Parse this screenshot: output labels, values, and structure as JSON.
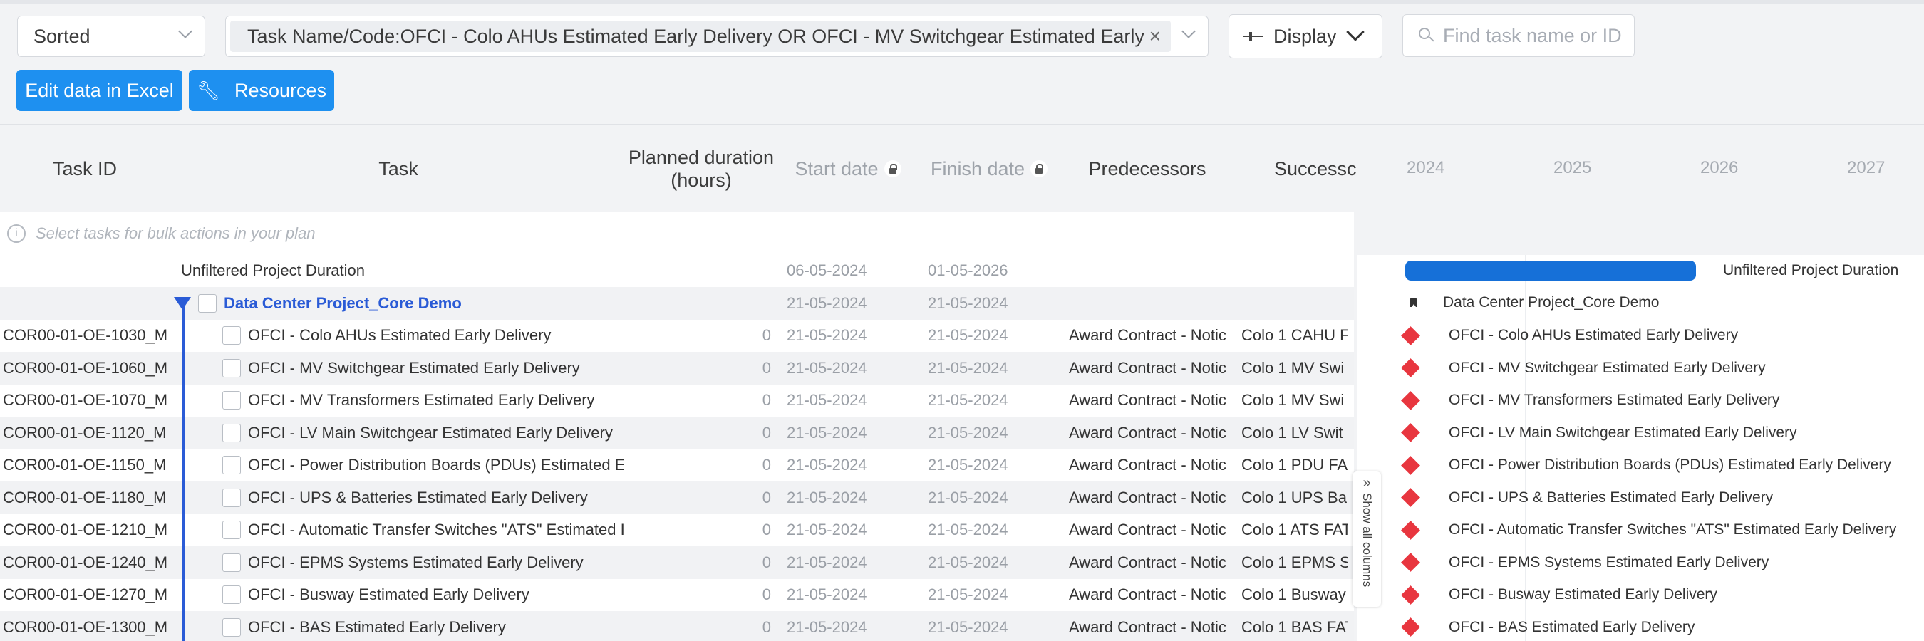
{
  "toolbar": {
    "sort_label": "Sorted",
    "filter_text": "Task Name/Code:OFCI - Colo AHUs Estimated Early Delivery OR OFCI - MV Switchgear Estimated Early Del...",
    "filter_clear": "×",
    "display_label": "Display",
    "search_placeholder": "Find task name or ID",
    "edit_excel_label": "Edit data in Excel",
    "resources_label": "Resources"
  },
  "columns": {
    "task_id": "Task ID",
    "task": "Task",
    "planned_duration": "Planned duration (hours)",
    "start_date": "Start date",
    "finish_date": "Finish date",
    "predecessors": "Predecessors",
    "successors": "Successc"
  },
  "timeline_years": [
    "2024",
    "2025",
    "2026",
    "2027"
  ],
  "bulk_actions_hint": "Select tasks for bulk actions in your plan",
  "summary_row": {
    "task": "Unfiltered Project Duration",
    "start": "06-05-2024",
    "finish": "01-05-2026"
  },
  "project_row": {
    "task": "Data Center Project_Core Demo",
    "start": "21-05-2024",
    "finish": "21-05-2024"
  },
  "tasks": [
    {
      "id": "COR00-01-OE-1030_M",
      "name": "OFCI - Colo AHUs Estimated Early Delivery",
      "duration": "0",
      "start": "21-05-2024",
      "finish": "21-05-2024",
      "pred": "Award Contract - Notic",
      "succ": "Colo 1 CAHU F",
      "gantt_label": "OFCI - Colo AHUs Estimated Early Delivery"
    },
    {
      "id": "COR00-01-OE-1060_M",
      "name": "OFCI - MV Switchgear Estimated Early Delivery",
      "duration": "0",
      "start": "21-05-2024",
      "finish": "21-05-2024",
      "pred": "Award Contract - Notic",
      "succ": "Colo 1 MV Swi",
      "gantt_label": "OFCI - MV Switchgear Estimated Early Delivery"
    },
    {
      "id": "COR00-01-OE-1070_M",
      "name": "OFCI - MV Transformers Estimated Early Delivery",
      "duration": "0",
      "start": "21-05-2024",
      "finish": "21-05-2024",
      "pred": "Award Contract - Notic",
      "succ": "Colo 1 MV Swi",
      "gantt_label": "OFCI - MV Transformers Estimated Early Delivery"
    },
    {
      "id": "COR00-01-OE-1120_M",
      "name": "OFCI - LV Main Switchgear Estimated Early Delivery",
      "duration": "0",
      "start": "21-05-2024",
      "finish": "21-05-2024",
      "pred": "Award Contract - Notic",
      "succ": "Colo 1 LV Swit",
      "gantt_label": "OFCI - LV Main Switchgear Estimated Early Delivery"
    },
    {
      "id": "COR00-01-OE-1150_M",
      "name": "OFCI - Power Distribution Boards (PDUs) Estimated E",
      "duration": "0",
      "start": "21-05-2024",
      "finish": "21-05-2024",
      "pred": "Award Contract - Notic",
      "succ": "Colo 1 PDU FA",
      "gantt_label": "OFCI - Power Distribution Boards (PDUs) Estimated Early Delivery"
    },
    {
      "id": "COR00-01-OE-1180_M",
      "name": "OFCI - UPS & Batteries Estimated Early Delivery",
      "duration": "0",
      "start": "21-05-2024",
      "finish": "21-05-2024",
      "pred": "Award Contract - Notic",
      "succ": "Colo 1 UPS Ba",
      "gantt_label": "OFCI - UPS & Batteries Estimated Early Delivery"
    },
    {
      "id": "COR00-01-OE-1210_M",
      "name": "OFCI - Automatic Transfer Switches \"ATS\" Estimated I",
      "duration": "0",
      "start": "21-05-2024",
      "finish": "21-05-2024",
      "pred": "Award Contract - Notic",
      "succ": "Colo 1 ATS FAT",
      "gantt_label": "OFCI - Automatic Transfer Switches \"ATS\" Estimated Early Delivery"
    },
    {
      "id": "COR00-01-OE-1240_M",
      "name": "OFCI - EPMS Systems Estimated Early Delivery",
      "duration": "0",
      "start": "21-05-2024",
      "finish": "21-05-2024",
      "pred": "Award Contract - Notic",
      "succ": "Colo 1 EPMS S",
      "gantt_label": "OFCI - EPMS Systems Estimated Early Delivery"
    },
    {
      "id": "COR00-01-OE-1270_M",
      "name": "OFCI - Busway Estimated Early Delivery",
      "duration": "0",
      "start": "21-05-2024",
      "finish": "21-05-2024",
      "pred": "Award Contract - Notic",
      "succ": "Colo 1 Busway",
      "gantt_label": "OFCI - Busway Estimated Early Delivery"
    },
    {
      "id": "COR00-01-OE-1300_M",
      "name": "OFCI - BAS Estimated Early Delivery",
      "duration": "0",
      "start": "21-05-2024",
      "finish": "21-05-2024",
      "pred": "Award Contract - Notic",
      "succ": "Colo 1 BAS FAT",
      "gantt_label": "OFCI - BAS Estimated Early Delivery"
    }
  ],
  "show_all_columns": "Show all columns",
  "colors": {
    "accent": "#1e90f0",
    "project_blue": "#2a5bd6",
    "gantt_bar": "#1670d8",
    "milestone": "#e8363f"
  }
}
